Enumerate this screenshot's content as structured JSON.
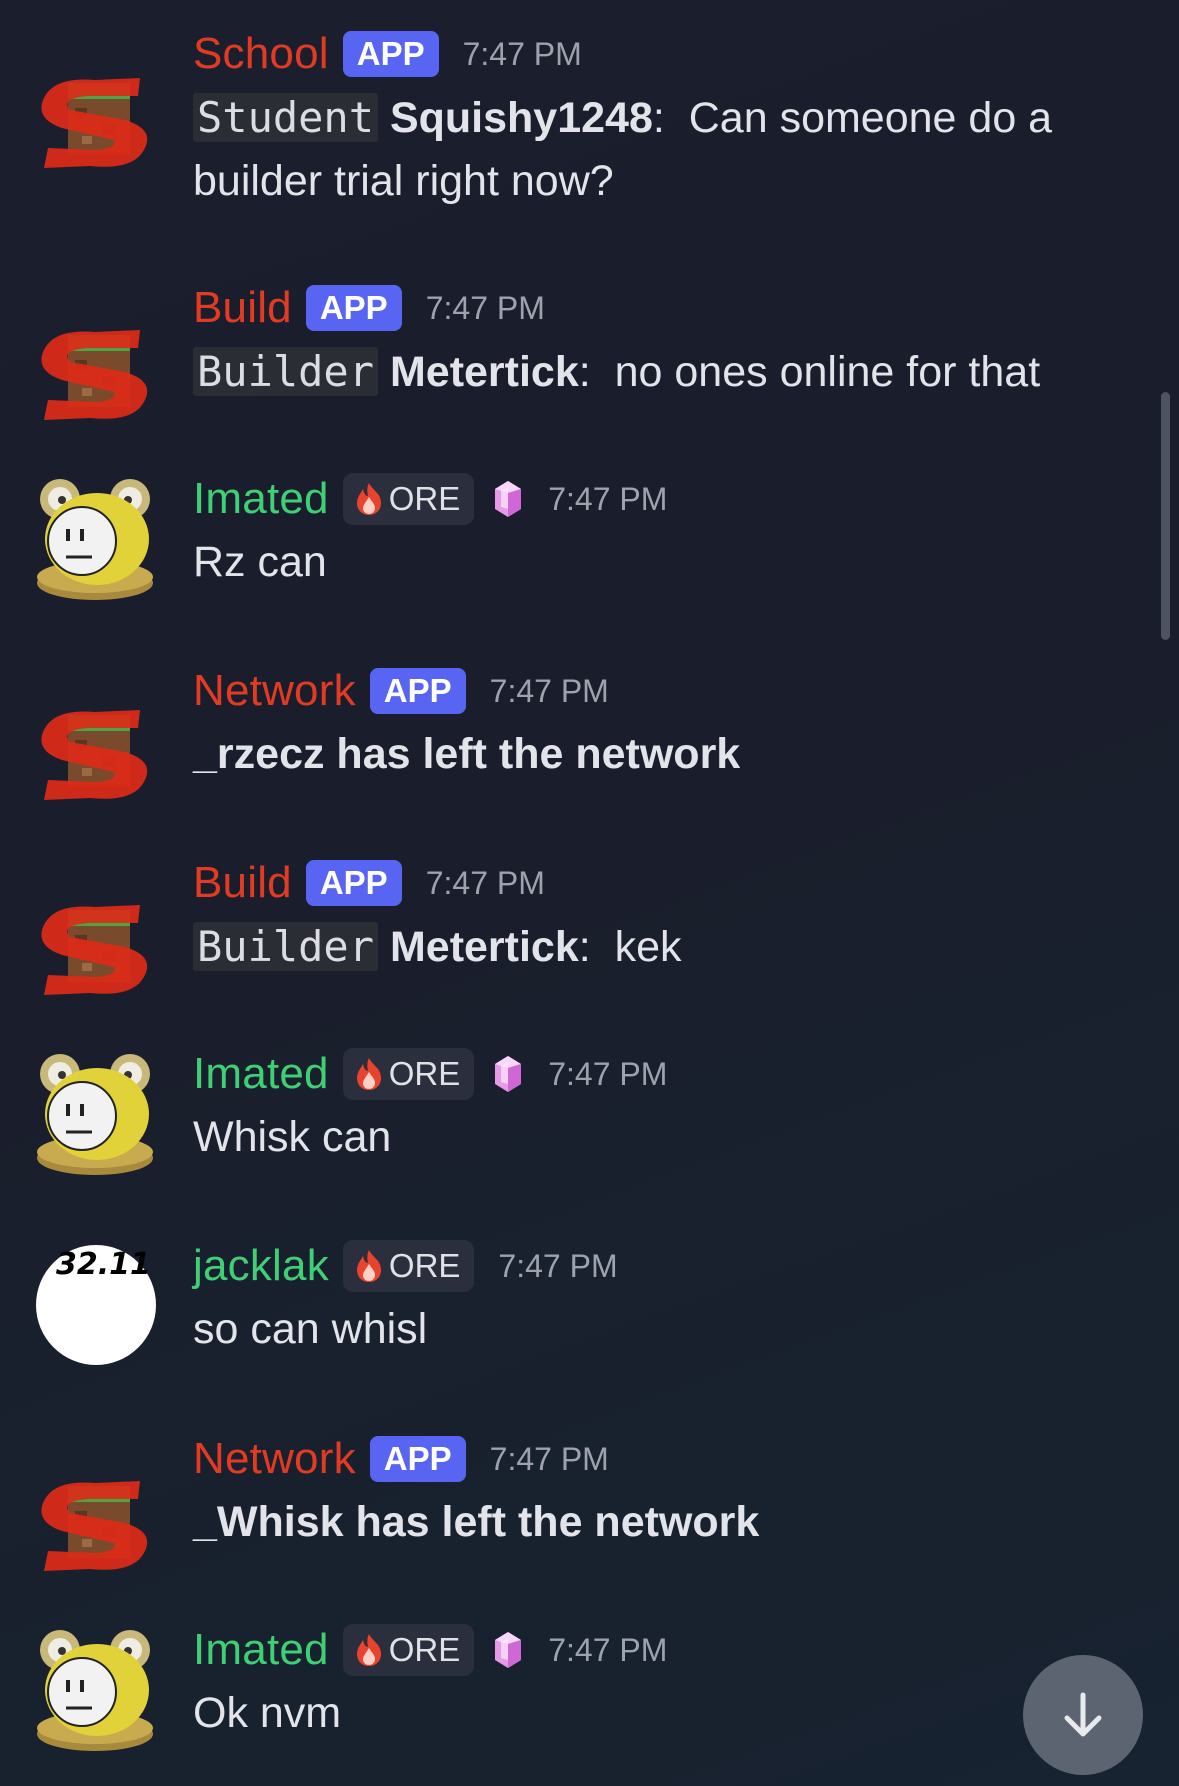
{
  "messages": [
    {
      "author": "School",
      "author_color": "#e33b22",
      "badge": "APP",
      "time": "7:47 PM",
      "role": "Student",
      "username": "Squishy1248",
      "text": "Can someone do a builder trial right now?",
      "avatar": "server-logo"
    },
    {
      "author": "Build",
      "author_color": "#e33b22",
      "badge": "APP",
      "time": "7:47 PM",
      "role": "Builder",
      "username": "Metertick",
      "text": "no ones online for that",
      "avatar": "server-logo"
    },
    {
      "author": "Imated",
      "author_color": "#3fcf74",
      "badge": "ORE",
      "time": "7:47 PM",
      "text": "Rz can",
      "avatar": "frog-hat"
    },
    {
      "author": "Network",
      "author_color": "#e33b22",
      "badge": "APP",
      "time": "7:47 PM",
      "text": "_rzecz has left the network",
      "avatar": "server-logo"
    },
    {
      "author": "Build",
      "author_color": "#e33b22",
      "badge": "APP",
      "time": "7:47 PM",
      "role": "Builder",
      "username": "Metertick",
      "text": "kek",
      "avatar": "server-logo"
    },
    {
      "author": "Imated",
      "author_color": "#3fcf74",
      "badge": "ORE",
      "time": "7:47 PM",
      "text": "Whisk can",
      "avatar": "frog-hat"
    },
    {
      "author": "jacklak",
      "author_color": "#3fcf74",
      "badge": "ORE",
      "time": "7:47 PM",
      "text": "so can whisl",
      "avatar": "white-circle",
      "avatar_text": "32.11"
    },
    {
      "author": "Network",
      "author_color": "#e33b22",
      "badge": "APP",
      "time": "7:47 PM",
      "text": "_Whisk has left the network",
      "avatar": "server-logo"
    },
    {
      "author": "Imated",
      "author_color": "#3fcf74",
      "badge": "ORE",
      "time": "7:47 PM",
      "text": "Ok nvm",
      "avatar": "frog-hat"
    }
  ],
  "icons": {
    "jump_button": "arrow-down-icon",
    "ore_badge": "fire-icon",
    "booster": "gem-icon"
  }
}
